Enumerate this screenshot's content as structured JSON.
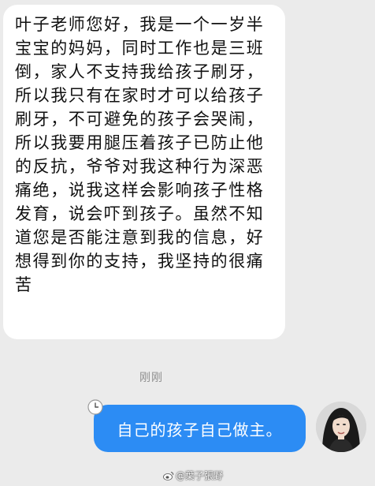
{
  "conversation": {
    "received_message": "叶子老师您好，我是一个一岁半宝宝的妈妈，同时工作也是三班倒，家人不支持我给孩子刷牙，所以我只有在家时才可以给孩子刷牙，不可避免的孩子会哭闹，所以我要用腿压着孩子已防止他的反抗，爷爷对我这种行为深恶痛绝，说我这样会影响孩子性格发育，说会吓到孩子。虽然不知道您是否能注意到我的信息，好想得到你的支持，我坚持的很痛苦",
    "timestamp": "刚刚",
    "sent_message": "自己的孩子自己做主。"
  },
  "watermark": {
    "handle": "@葉子張野"
  },
  "colors": {
    "background": "#ebebeb",
    "received_bubble": "#ffffff",
    "sent_bubble": "#2c8cf4",
    "timestamp_text": "#8e8e8e"
  },
  "icons": {
    "pending": "clock-icon",
    "watermark_logo": "weibo-icon"
  }
}
